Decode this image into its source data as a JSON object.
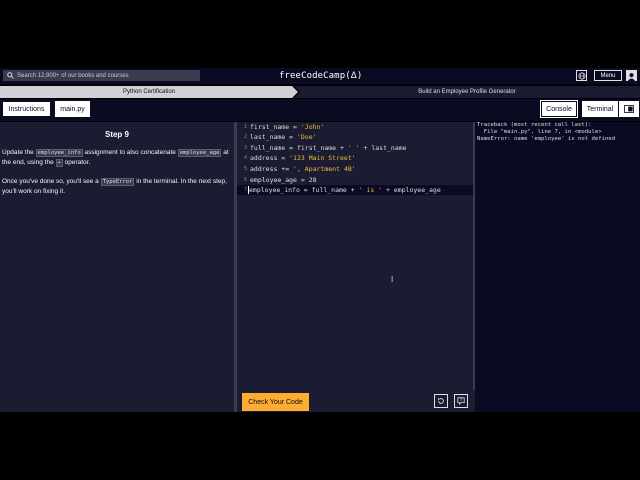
{
  "nav": {
    "search_placeholder": "Search 12,900+ of our books and courses",
    "brand": "freeCodeCamp(",
    "brand_icon_text": "Δ",
    "brand_close": ")",
    "menu_label": "Menu"
  },
  "breadcrumb": {
    "items": [
      {
        "label": "Python Certification"
      },
      {
        "label": "Build an Employee Profile Generator"
      }
    ]
  },
  "tabs": {
    "instructions": "Instructions",
    "main": "main.py",
    "console": "Console",
    "terminal": "Terminal"
  },
  "instructions": {
    "step_title": "Step 9",
    "p1_a": "Update the ",
    "p1_code1": "employee_info",
    "p1_b": " assignment to also concatenate ",
    "p1_code2": "employee_age",
    "p1_c": " at the end, using the ",
    "p1_code3": "+",
    "p1_d": " operator.",
    "p2_a": "Once you've done so, you'll see a ",
    "p2_code1": "TypeError",
    "p2_b": " in the terminal. In the next step, you'll work on fixing it."
  },
  "editor": {
    "lines": [
      {
        "num": "1",
        "pre": "first_name = ",
        "str": "'John'",
        "post": ""
      },
      {
        "num": "2",
        "pre": "last_name = ",
        "str": "'Doe'",
        "post": ""
      },
      {
        "num": "3",
        "pre": "full_name = first_name + ",
        "str": "' '",
        "post": " + last_name"
      },
      {
        "num": "4",
        "pre": "address = ",
        "str": "'123 Main Street'",
        "post": ""
      },
      {
        "num": "5",
        "pre": "address += ",
        "str": "', Apartment 4B'",
        "post": ""
      },
      {
        "num": "6",
        "pre": "employee_age = 28",
        "str": "",
        "post": ""
      },
      {
        "num": "7",
        "pre": "employee_info = full_name + ",
        "str": "' is '",
        "post": " + employee_age"
      }
    ],
    "check_button": "Check Your Code"
  },
  "terminal": {
    "lines": [
      "Traceback (most recent call last):",
      "  File \"main.py\", line 7, in <module>",
      "NameError: name 'employee' is not defined"
    ]
  },
  "colors": {
    "accent": "#feac32",
    "string": "#f1be32",
    "background": "#0a0a23",
    "panel": "#1b1b32"
  }
}
